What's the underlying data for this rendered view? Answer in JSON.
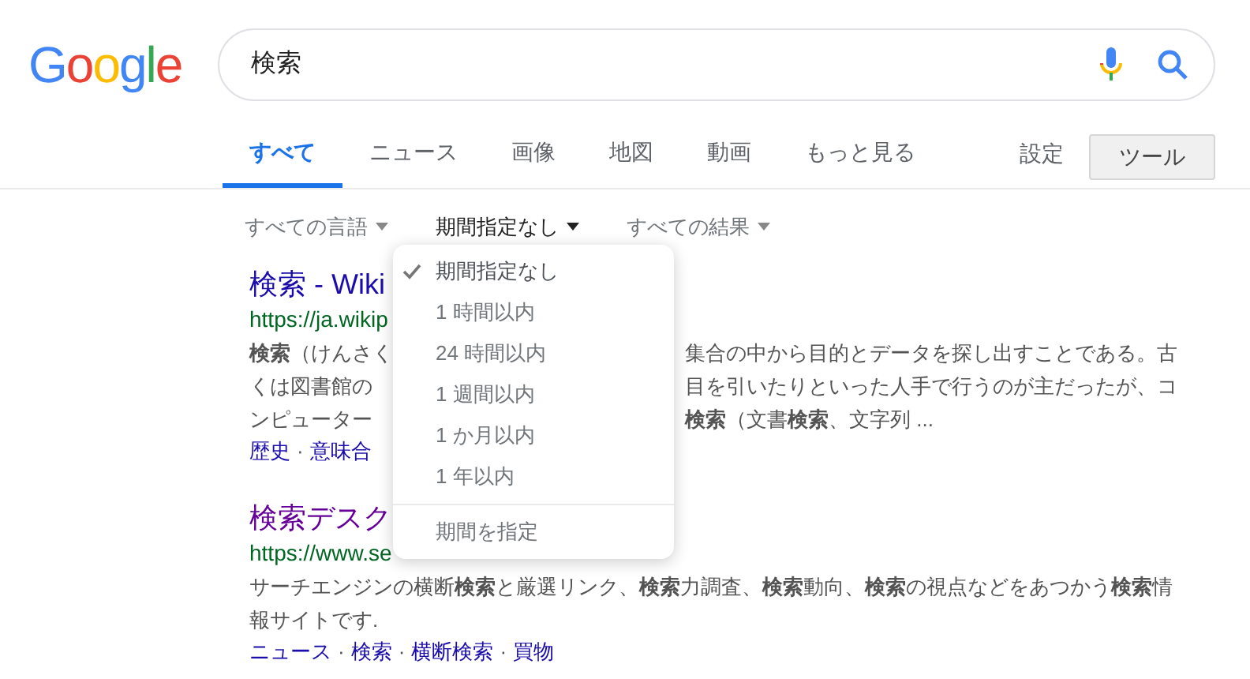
{
  "logo": {
    "letters": [
      {
        "char": "G",
        "color": "#4285f4"
      },
      {
        "char": "o",
        "color": "#ea4335"
      },
      {
        "char": "o",
        "color": "#fbbc05"
      },
      {
        "char": "g",
        "color": "#4285f4"
      },
      {
        "char": "l",
        "color": "#34a853"
      },
      {
        "char": "e",
        "color": "#ea4335"
      }
    ]
  },
  "search": {
    "value": "検索"
  },
  "tabs": [
    {
      "label": "すべて",
      "selected": true
    },
    {
      "label": "ニュース",
      "selected": false
    },
    {
      "label": "画像",
      "selected": false
    },
    {
      "label": "地図",
      "selected": false
    },
    {
      "label": "動画",
      "selected": false
    },
    {
      "label": "もっと見る",
      "selected": false
    }
  ],
  "settings": "設定",
  "link_separator": "·",
  "tools_button": "ツール",
  "filters": [
    {
      "label": "すべての言語",
      "expanded": false
    },
    {
      "label": "期間指定なし",
      "expanded": true
    },
    {
      "label": "すべての結果",
      "expanded": false
    }
  ],
  "results": [
    {
      "title": "検索 - Wiki",
      "visited": false,
      "url": "https://ja.wikip",
      "lines": [
        {
          "left": "**検索**（けんさく",
          "right": "集合の中から目的とデータを探し出すことである。古"
        },
        {
          "left": "くは図書館の",
          "right": "目を引いたりといった人手で行うのが主だったが、コ"
        },
        {
          "left": "ンピューター",
          "right": "**検索**（文書**検索**、文字列 ..."
        }
      ],
      "links": [
        "歴史",
        "意味合"
      ]
    },
    {
      "title": "検索デスク",
      "visited": true,
      "url": "https://www.se",
      "lines": [
        {
          "left": "サーチエンジンの横断**検索**と厳選リンク、**検索**力調査、**検索**動向、**検索**の視点などをあつかう**検索**情"
        },
        {
          "left": "報サイトです."
        }
      ],
      "links": [
        "ニュース",
        "検索",
        "横断検索",
        "買物"
      ]
    }
  ],
  "menu": {
    "items": [
      {
        "label": "期間指定なし",
        "selected": true
      },
      {
        "label": "1 時間以内",
        "selected": false
      },
      {
        "label": "24 時間以内",
        "selected": false
      },
      {
        "label": "1 週間以内",
        "selected": false
      },
      {
        "label": "1 か月以内",
        "selected": false
      },
      {
        "label": "1 年以内",
        "selected": false
      }
    ],
    "footer": "期間を指定"
  }
}
